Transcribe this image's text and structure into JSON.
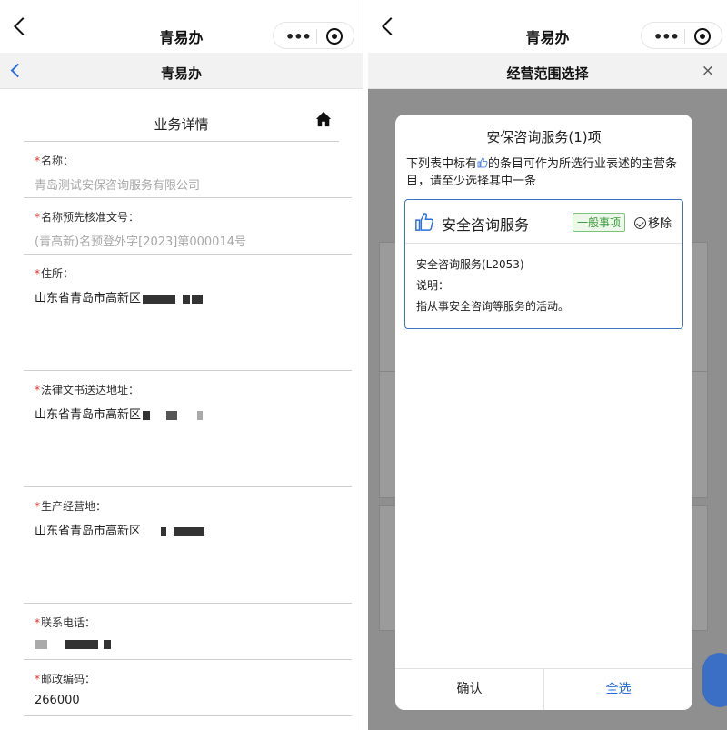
{
  "left": {
    "app_title": "青易办",
    "sub_title": "青易办",
    "detail_title": "业务详情",
    "fields": [
      {
        "label": "名称：",
        "value": "青岛测试安保咨询服务有限公司"
      },
      {
        "label": "名称预先核准文号：",
        "value": "(青高新)名预登外字[2023]第000014号"
      },
      {
        "label": "住所：",
        "value": "山东省青岛市高新区"
      },
      {
        "label": "法律文书送达地址：",
        "value": "山东省青岛市高新区"
      },
      {
        "label": "生产经营地：",
        "value": "山东省青岛市高新区"
      },
      {
        "label": "联系电话：",
        "value": ""
      },
      {
        "label": "邮政编码：",
        "value": "266000"
      }
    ],
    "required_mark": "*"
  },
  "right": {
    "app_title": "青易办",
    "sub_title": "经营范围选择",
    "close_glyph": "×",
    "modal": {
      "title": "安保咨询服务(1)项",
      "hint_before": "下列表中标有",
      "hint_after": "的条目可作为所选行业表述的主营条目，请至少选择其中一条",
      "card": {
        "name": "安全咨询服务",
        "tag": "一般事项",
        "remove": "移除",
        "code": "安全咨询服务(L2053)",
        "note_label": "说明：",
        "note": "指从事安全咨询等服务的活动。"
      },
      "confirm": "确认",
      "select_all": "全选"
    }
  },
  "colors": {
    "accent": "#2a6fe0",
    "required": "#e0302a",
    "tag_green": "#3f9c3f",
    "card_border": "#3b73c5"
  }
}
